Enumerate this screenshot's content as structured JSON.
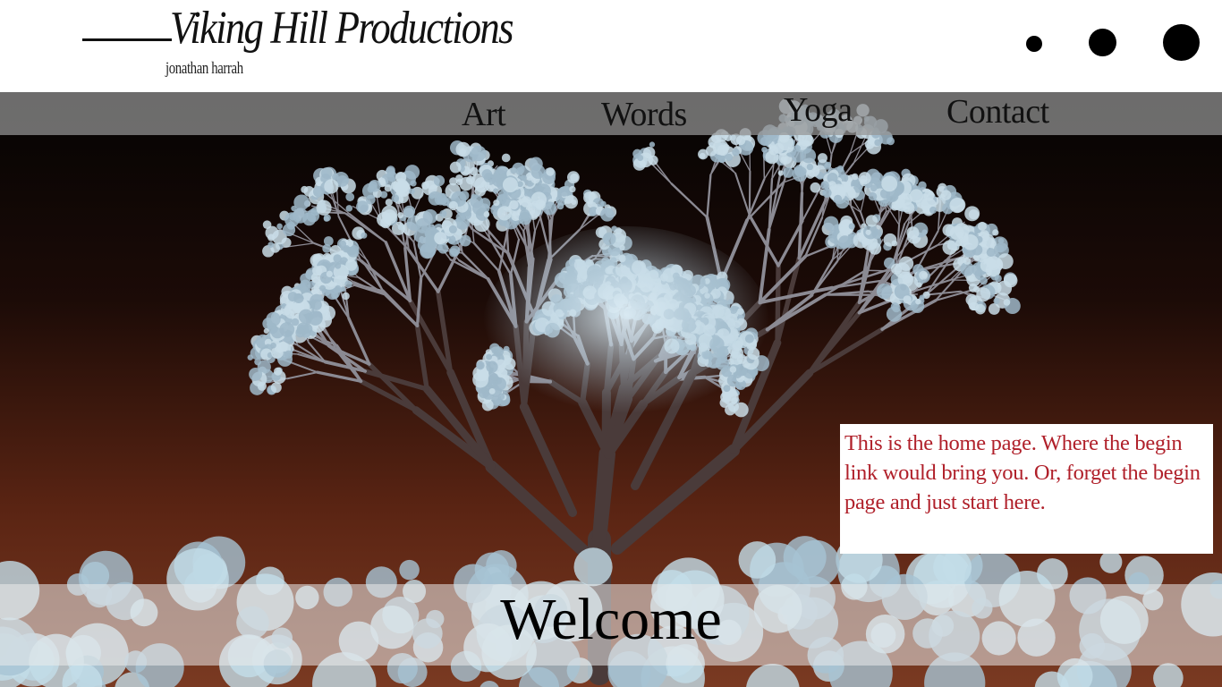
{
  "header": {
    "brand_title": "Viking Hill Productions",
    "brand_subtitle": "jonathan harrah"
  },
  "nav": {
    "items": [
      {
        "label": "Art"
      },
      {
        "label": "Words"
      },
      {
        "label": "Yoga"
      },
      {
        "label": "Contact"
      }
    ]
  },
  "info_box": {
    "text": "This is the home page. Where the begin link would bring you. Or, forget the begin page and just start here."
  },
  "hero": {
    "welcome": "Welcome"
  },
  "colors": {
    "info_text": "#b0202a",
    "nav_bar": "#969696",
    "sky_top": "#050404",
    "sky_bottom": "#6a2a17",
    "foliage": "#b9d6e4"
  },
  "icons": [
    "dot-small-icon",
    "dot-medium-icon",
    "dot-large-icon"
  ]
}
